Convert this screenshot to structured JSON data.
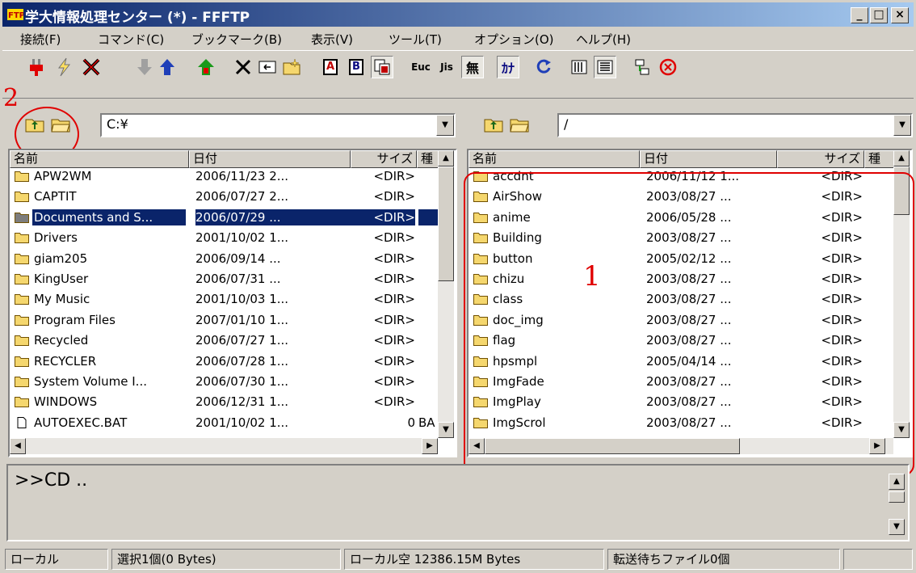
{
  "window": {
    "title": "学大情報処理センター (*) - FFFTP"
  },
  "menu": [
    "接続(F)",
    "コマンド(C)",
    "ブックマーク(B)",
    "表示(V)",
    "ツール(T)",
    "オプション(O)",
    "ヘルプ(H)"
  ],
  "toolbar": {
    "a_label": "A",
    "b_label": "B",
    "eu_label": "Euc",
    "js_label": "Jis",
    "mu_label": "無",
    "kana_label": "ｶﾅ"
  },
  "local": {
    "path": "C:¥",
    "headers": [
      "名前",
      "日付",
      "サイズ",
      "種"
    ],
    "rows": [
      {
        "name": "APW2WM",
        "date": "2006/11/23 2...",
        "size": "<DIR>",
        "type": "",
        "kind": "folder"
      },
      {
        "name": "CAPTIT",
        "date": "2006/07/27 2...",
        "size": "<DIR>",
        "type": "",
        "kind": "folder"
      },
      {
        "name": "Documents and S...",
        "date": "2006/07/29 ...",
        "size": "<DIR>",
        "type": "",
        "kind": "folder"
      },
      {
        "name": "Drivers",
        "date": "2001/10/02 1...",
        "size": "<DIR>",
        "type": "",
        "kind": "folder"
      },
      {
        "name": "giam205",
        "date": "2006/09/14 ...",
        "size": "<DIR>",
        "type": "",
        "kind": "folder"
      },
      {
        "name": "KingUser",
        "date": "2006/07/31 ...",
        "size": "<DIR>",
        "type": "",
        "kind": "folder"
      },
      {
        "name": "My Music",
        "date": "2001/10/03 1...",
        "size": "<DIR>",
        "type": "",
        "kind": "folder"
      },
      {
        "name": "Program Files",
        "date": "2007/01/10 1...",
        "size": "<DIR>",
        "type": "",
        "kind": "folder"
      },
      {
        "name": "Recycled",
        "date": "2006/07/27 1...",
        "size": "<DIR>",
        "type": "",
        "kind": "folder"
      },
      {
        "name": "RECYCLER",
        "date": "2006/07/28 1...",
        "size": "<DIR>",
        "type": "",
        "kind": "folder"
      },
      {
        "name": "System Volume I...",
        "date": "2006/07/30 1...",
        "size": "<DIR>",
        "type": "",
        "kind": "folder"
      },
      {
        "name": "WINDOWS",
        "date": "2006/12/31 1...",
        "size": "<DIR>",
        "type": "",
        "kind": "folder"
      },
      {
        "name": "AUTOEXEC.BAT",
        "date": "2001/10/02 1...",
        "size": "0",
        "type": "BA",
        "kind": "file"
      }
    ]
  },
  "remote": {
    "path": "/",
    "headers": [
      "名前",
      "日付",
      "サイズ",
      "種"
    ],
    "rows": [
      {
        "name": "accdnt",
        "date": "2006/11/12 1...",
        "size": "<DIR>"
      },
      {
        "name": "AirShow",
        "date": "2003/08/27 ...",
        "size": "<DIR>"
      },
      {
        "name": "anime",
        "date": "2006/05/28 ...",
        "size": "<DIR>"
      },
      {
        "name": "Building",
        "date": "2003/08/27 ...",
        "size": "<DIR>"
      },
      {
        "name": "button",
        "date": "2005/02/12 ...",
        "size": "<DIR>"
      },
      {
        "name": "chizu",
        "date": "2003/08/27 ...",
        "size": "<DIR>"
      },
      {
        "name": "class",
        "date": "2003/08/27 ...",
        "size": "<DIR>"
      },
      {
        "name": "doc_img",
        "date": "2003/08/27 ...",
        "size": "<DIR>"
      },
      {
        "name": "flag",
        "date": "2003/08/27 ...",
        "size": "<DIR>"
      },
      {
        "name": "hpsmpl",
        "date": "2005/04/14 ...",
        "size": "<DIR>"
      },
      {
        "name": "ImgFade",
        "date": "2003/08/27 ...",
        "size": "<DIR>"
      },
      {
        "name": "ImgPlay",
        "date": "2003/08/27 ...",
        "size": "<DIR>"
      },
      {
        "name": "ImgScrol",
        "date": "2003/08/27 ...",
        "size": "<DIR>"
      }
    ]
  },
  "log": {
    "text": ">>CD .."
  },
  "status": {
    "local": "ローカル",
    "selection": "選択1個(0 Bytes)",
    "free": "ローカル空 12386.15M Bytes",
    "queue": "転送待ちファイル0個"
  },
  "annotations": {
    "one": "1",
    "two": "2"
  },
  "colors": {
    "annotation": "#e00000",
    "selection": "#0a246a",
    "folder": "#f5d76e"
  }
}
